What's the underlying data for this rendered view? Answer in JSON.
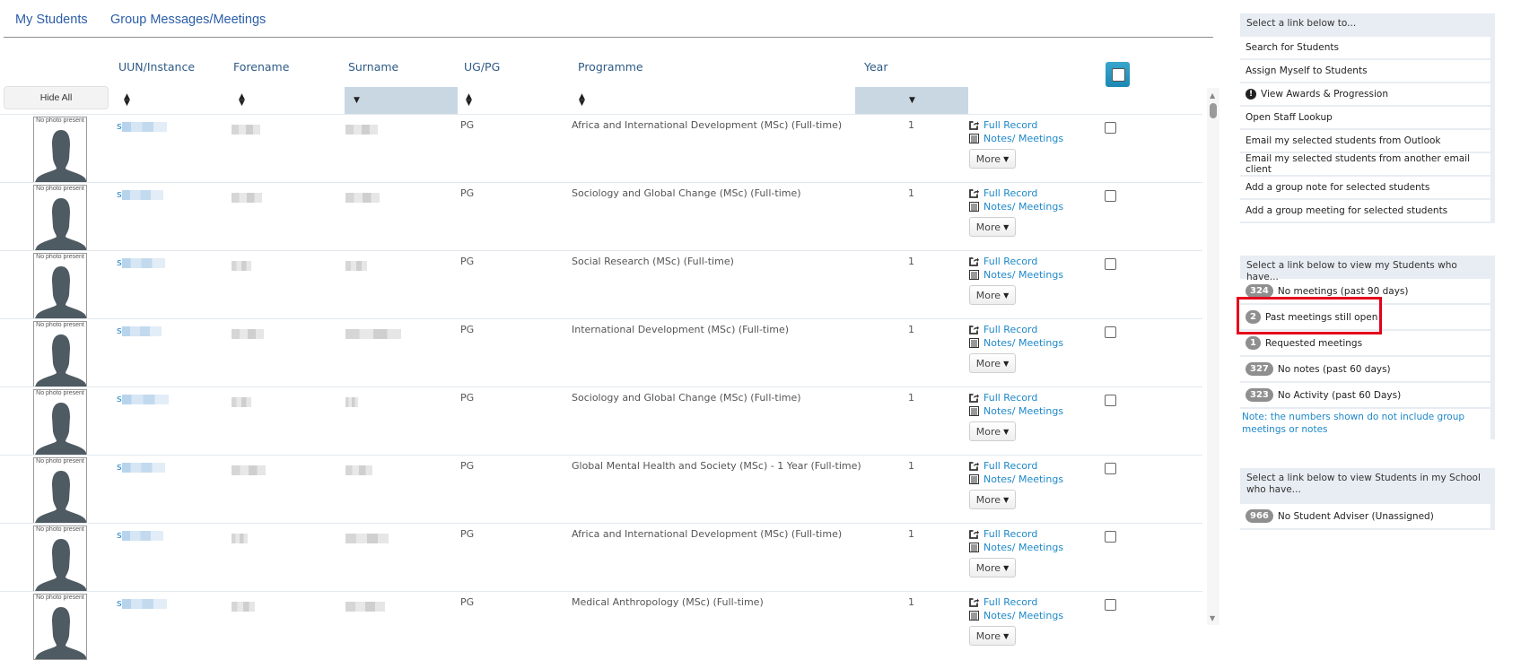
{
  "tabs": [
    {
      "label": "My Students",
      "active": true
    },
    {
      "label": "Group Messages/Meetings",
      "active": false
    }
  ],
  "table": {
    "hide_all_label": "Hide All",
    "columns": [
      "UUN/Instance",
      "Forename",
      "Surname",
      "UG/PG",
      "Programme",
      "Year"
    ],
    "sorted_columns": [
      "Surname",
      "Year"
    ],
    "photo_caption": "No photo present",
    "uun_prefix": "s",
    "actions": {
      "full_record": "Full Record",
      "notes_meetings": "Notes/ Meetings",
      "more": "More"
    },
    "rows": [
      {
        "ugpg": "PG",
        "programme": "Africa and International Development (MSc) (Full-time)",
        "year": "1"
      },
      {
        "ugpg": "PG",
        "programme": "Sociology and Global Change (MSc) (Full-time)",
        "year": "1"
      },
      {
        "ugpg": "PG",
        "programme": "Social Research (MSc) (Full-time)",
        "year": "1"
      },
      {
        "ugpg": "PG",
        "programme": "International Development (MSc) (Full-time)",
        "year": "1"
      },
      {
        "ugpg": "PG",
        "programme": "Sociology and Global Change (MSc) (Full-time)",
        "year": "1"
      },
      {
        "ugpg": "PG",
        "programme": "Global Mental Health and Society (MSc) - 1 Year (Full-time)",
        "year": "1"
      },
      {
        "ugpg": "PG",
        "programme": "Africa and International Development (MSc) (Full-time)",
        "year": "1"
      },
      {
        "ugpg": "PG",
        "programme": "Medical Anthropology (MSc) (Full-time)",
        "year": "1"
      }
    ]
  },
  "sidebar": {
    "panel1": {
      "header": "Select a link below to...",
      "items": [
        {
          "label": "Search for Students"
        },
        {
          "label": "Assign Myself to Students"
        },
        {
          "label": "View Awards & Progression",
          "icon": "exclamation-circle-icon"
        },
        {
          "label": "Open Staff Lookup"
        },
        {
          "label": "Email my selected students from Outlook"
        },
        {
          "label": "Email my selected students from another email client"
        },
        {
          "label": "Add a group note for selected students"
        },
        {
          "label": "Add a group meeting for selected students"
        }
      ]
    },
    "panel2": {
      "header": "Select a link below to view my Students who have...",
      "items": [
        {
          "count": "324",
          "label": "No meetings (past 90 days)"
        },
        {
          "count": "2",
          "label": "Past meetings still open"
        },
        {
          "count": "1",
          "label": "Requested meetings"
        },
        {
          "count": "327",
          "label": "No notes (past 60 days)"
        },
        {
          "count": "323",
          "label": "No Activity (past 60 Days)"
        }
      ],
      "note": "Note: the numbers shown do not include group meetings or notes"
    },
    "panel3": {
      "header": "Select a link below to view Students in my School who have...",
      "items": [
        {
          "count": "966",
          "label": "No Student Adviser (Unassigned)"
        }
      ]
    }
  },
  "colors": {
    "link": "#1e88c9",
    "header_text": "#2e5a86",
    "highlight": "#e3001b",
    "sorted_bg": "#c9d7e3",
    "badge": "#8f8f8f"
  }
}
